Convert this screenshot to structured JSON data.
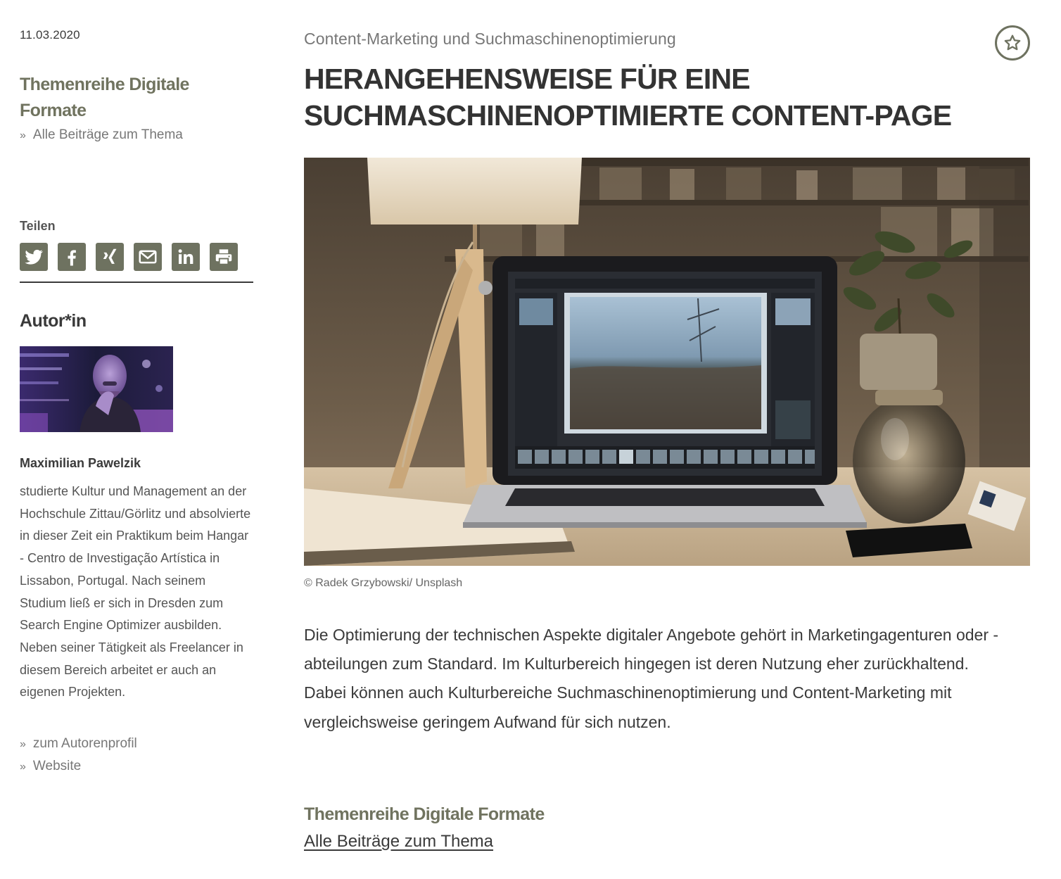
{
  "article": {
    "date": "11.03.2020",
    "category": "Content-Marketing und Suchmaschinenoptimierung",
    "headline": "HERANGEHENSWEISE FÜR EINE SUCHMASCHINENOPTIMIERTE CONTENT-PAGE",
    "image_credit": "© Radek Grzybowski/ Unsplash",
    "lead": "Die Optimierung der technischen Aspekte digitaler Angebote gehört in Marketingagenturen oder -abteilungen zum Standard. Im Kulturbereich hingegen ist deren Nutzung eher zurückhaltend. Dabei können auch Kulturbereiche Suchmaschinenoptimierung und Content-Marketing mit vergleichsweise geringem Aufwand für sich nutzen."
  },
  "series": {
    "title": "Themenreihe Digitale Formate",
    "all_posts_label": "Alle Beiträge zum Thema",
    "bullet": "»"
  },
  "share": {
    "label": "Teilen",
    "icons": [
      "twitter-icon",
      "facebook-icon",
      "xing-icon",
      "email-icon",
      "linkedin-icon",
      "print-icon"
    ]
  },
  "author": {
    "heading": "Autor*in",
    "name": "Maximilian Pawelzik",
    "bio": "studierte Kultur und Management an der Hochschule Zittau/Görlitz und absolvierte in dieser Zeit ein Praktikum beim Hangar - Centro de Investigação Artística in Lissabon, Portugal. Nach seinem Studium ließ er sich in Dresden zum Search Engine Optimizer ausbilden. Neben seiner Tätigkeit als Freelancer in diesem Bereich arbeitet er auch an eigenen Projekten.",
    "profile_link": "zum Autorenprofil",
    "website_link": "Website"
  },
  "footer": {
    "series_title": "Themenreihe Digitale Formate",
    "all_posts_link": "Alle Beiträge zum Thema"
  },
  "colors": {
    "accent_olive": "#6e7260",
    "series_title": "#70735f",
    "text": "#3a3a3a",
    "muted": "#777777"
  }
}
